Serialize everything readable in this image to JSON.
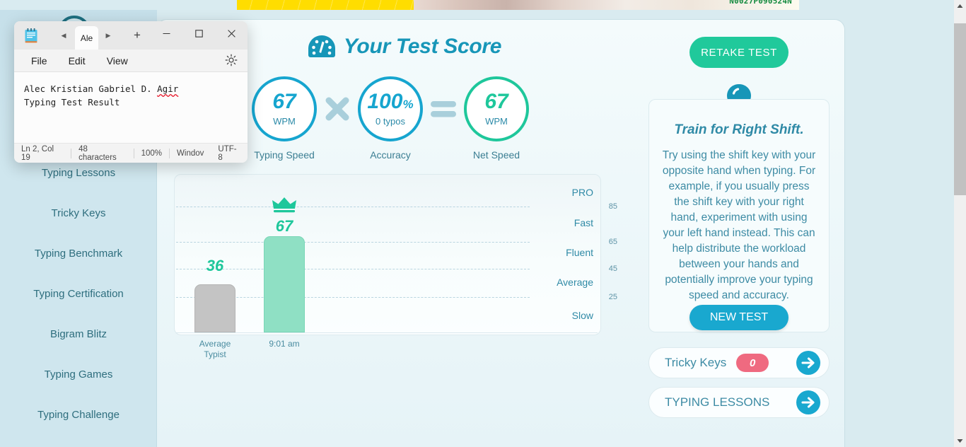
{
  "banner": {
    "serial": "N0027P090524N"
  },
  "sidebar": {
    "items": [
      {
        "label": "Typing Lessons"
      },
      {
        "label": "Tricky Keys"
      },
      {
        "label": "Typing Benchmark"
      },
      {
        "label": "Typing Certification"
      },
      {
        "label": "Bigram Blitz"
      },
      {
        "label": "Typing Games"
      },
      {
        "label": "Typing Challenge"
      }
    ]
  },
  "header": {
    "title": "Your Test Score",
    "retake_label": "RETAKE TEST"
  },
  "scores": [
    {
      "value": "67",
      "suffix": "",
      "sub": "WPM",
      "caption": "Typing Speed",
      "color": "#16a5cf"
    },
    {
      "value": "100",
      "suffix": "%",
      "sub": "0 typos",
      "caption": "Accuracy",
      "color": "#16a5cf"
    },
    {
      "value": "67",
      "suffix": "",
      "sub": "WPM",
      "caption": "Net Speed",
      "color": "#1ec79b"
    }
  ],
  "operators": {
    "multiply": "×",
    "equals": "="
  },
  "chart_data": {
    "type": "bar",
    "title": "",
    "categories": [
      "Average Typist",
      "9:01 am"
    ],
    "values": [
      36,
      67
    ],
    "bar_colors": [
      "#c4c4c4",
      "#8fe0c4"
    ],
    "data_labels": [
      "36",
      "67"
    ],
    "crown_on": "9:01 am",
    "ylabel": "",
    "xlabel": "",
    "ylim": [
      0,
      100
    ],
    "gridlines": [
      25,
      45,
      65,
      85
    ],
    "tick_labels": [
      "25",
      "45",
      "65",
      "85"
    ],
    "tier_labels": [
      "Slow",
      "Average",
      "Fluent",
      "Fast",
      "PRO"
    ],
    "tier_positions": [
      12.5,
      35,
      55,
      75,
      93
    ],
    "grid": true,
    "legend": "none",
    "x_labels": [
      [
        "Average",
        "Typist"
      ],
      [
        "9:01 am"
      ]
    ]
  },
  "tip": {
    "title": "Train for Right Shift.",
    "body": "Try using the shift key with your opposite hand when typing. For example, if you usually press the shift key with your right hand, experiment with using your left hand instead. This can help distribute the workload between your hands and potentially improve your typing speed and accuracy.",
    "button_label": "NEW TEST"
  },
  "pills": [
    {
      "label": "Tricky Keys",
      "badge": "0"
    },
    {
      "label": "TYPING LESSONS",
      "badge": null
    }
  ],
  "notepad": {
    "tab_label": "Ale",
    "menus": [
      "File",
      "Edit",
      "View"
    ],
    "line1_a": "Alec Kristian Gabriel D. ",
    "line1_b": "Agir",
    "line2": "Typing Test Result",
    "status": {
      "position": "Ln 2, Col 19",
      "characters": "48 characters",
      "zoom": "100%",
      "line_ending": "Windov",
      "encoding": "UTF-8"
    }
  }
}
